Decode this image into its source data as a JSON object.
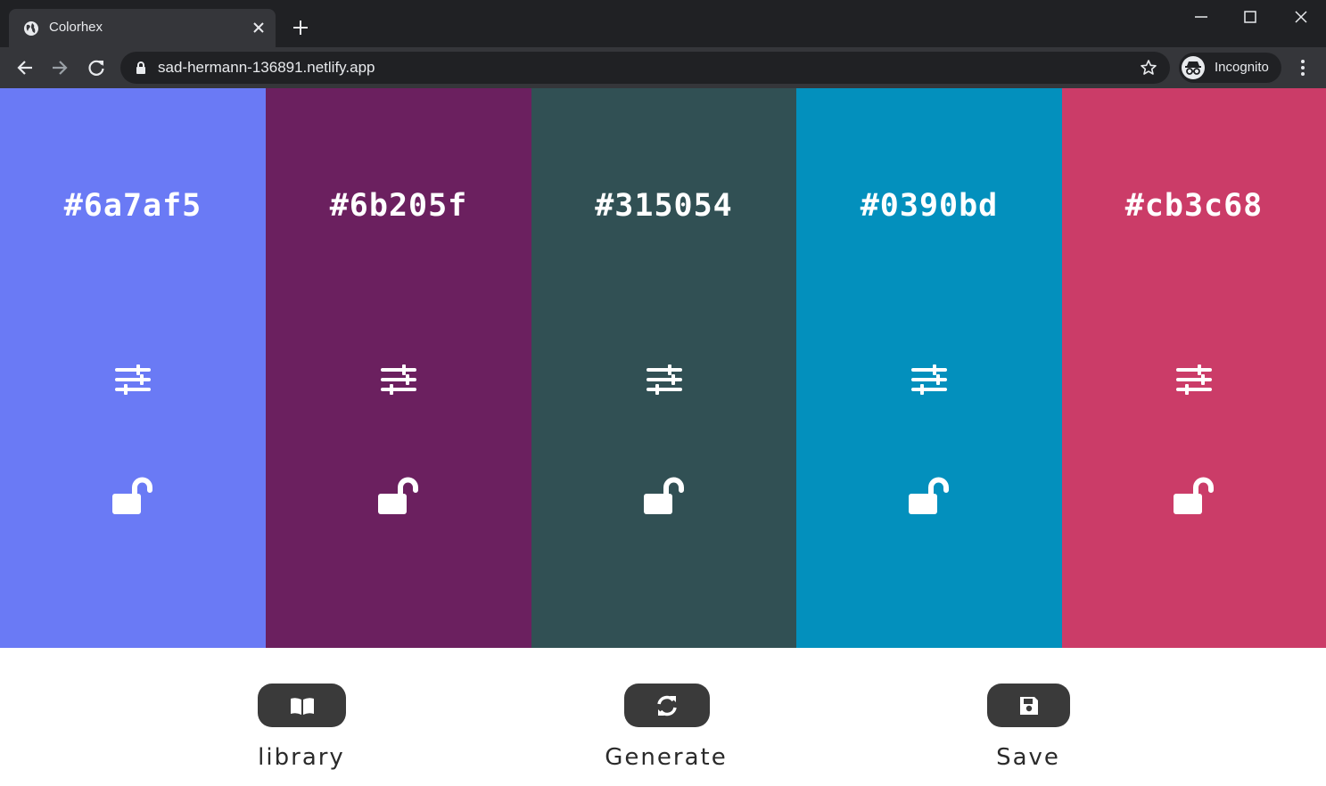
{
  "browser": {
    "tab_title": "Colorhex",
    "url": "sad-hermann-136891.netlify.app",
    "profile_label": "Incognito",
    "icons": {
      "favicon": "globe-icon",
      "tab_close": "close-icon",
      "new_tab": "plus-icon",
      "back": "arrow-left-icon",
      "forward": "arrow-right-icon",
      "reload": "reload-icon",
      "secure": "lock-icon",
      "bookmark": "star-icon",
      "incognito": "incognito-icon",
      "menu": "kebab-menu-icon",
      "window_controls": [
        "minimize-icon",
        "maximize-icon",
        "close-icon"
      ]
    },
    "colors": {
      "frame": "#202124",
      "toolbar": "#35363a",
      "text": "#e8eaed"
    }
  },
  "palette": {
    "swatches": [
      {
        "hex": "#6a7af5",
        "color": "#6a7af5",
        "adjust_icon": "sliders-icon",
        "lock_icon": "lock-open-icon",
        "locked": false
      },
      {
        "hex": "#6b205f",
        "color": "#6b205f",
        "adjust_icon": "sliders-icon",
        "lock_icon": "lock-open-icon",
        "locked": false
      },
      {
        "hex": "#315054",
        "color": "#315054",
        "adjust_icon": "sliders-icon",
        "lock_icon": "lock-open-icon",
        "locked": false
      },
      {
        "hex": "#0390bd",
        "color": "#0390bd",
        "adjust_icon": "sliders-icon",
        "lock_icon": "lock-open-icon",
        "locked": false
      },
      {
        "hex": "#cb3c68",
        "color": "#cb3c68",
        "adjust_icon": "sliders-icon",
        "lock_icon": "lock-open-icon",
        "locked": false
      }
    ]
  },
  "controls": {
    "library": {
      "label": "library",
      "icon": "book-open-icon"
    },
    "generate": {
      "label": "Generate",
      "icon": "sync-icon"
    },
    "save": {
      "label": "Save",
      "icon": "floppy-disk-icon"
    },
    "button_color": "#3a3a3a"
  }
}
